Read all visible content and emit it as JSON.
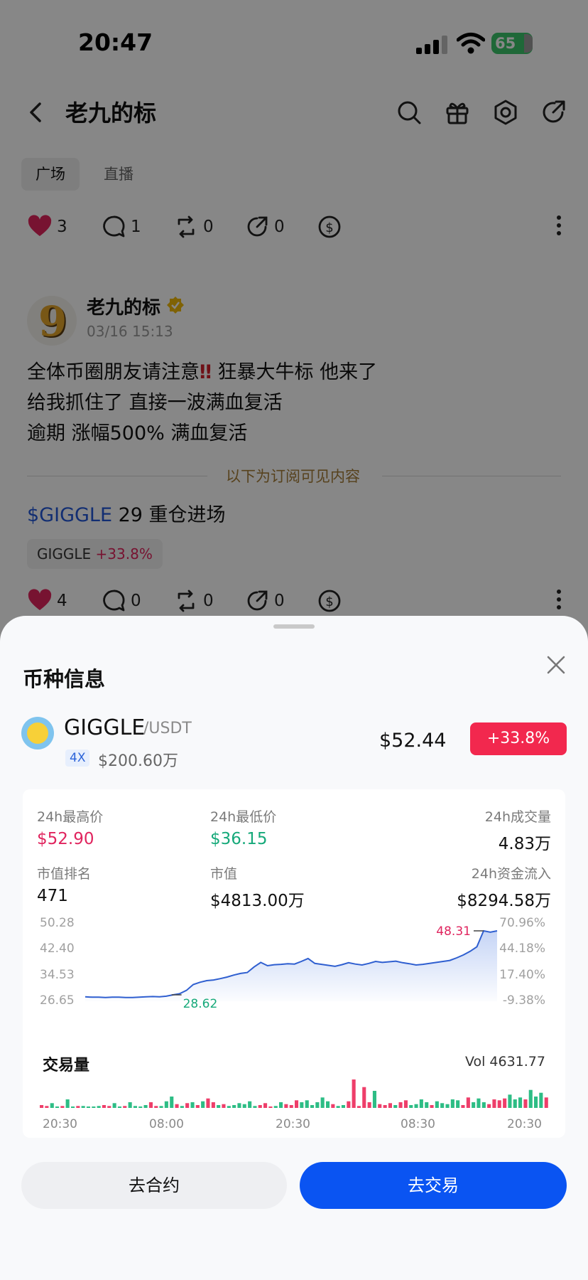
{
  "status_bar": {
    "time": "20:47",
    "battery": "65"
  },
  "nav": {
    "title": "老九的标",
    "icons": [
      "search-icon",
      "gift-icon",
      "settings-icon",
      "share-icon"
    ]
  },
  "tabs": [
    {
      "label": "广场",
      "active": true
    },
    {
      "label": "直播",
      "active": false
    }
  ],
  "top_actions": {
    "likes": "3",
    "comments": "1",
    "reposts": "0",
    "shares": "0"
  },
  "post": {
    "author": "老九的标",
    "time": "03/16 15:13",
    "lines": [
      "全体币圈朋友请注意",
      "狂暴大牛标 他来了",
      "给我抓住了 直接一波满血复活",
      "逾期 涨幅500% 满血复活"
    ],
    "bang": "‼",
    "subscriber_divider": "以下为订阅可见内容",
    "ticker": "$GIGGLE",
    "ticker_text": " 29 重仓进场",
    "chip_symbol": "GIGGLE",
    "chip_change": "+33.8%",
    "likes": "4",
    "comments": "0",
    "reposts": "0",
    "shares": "0"
  },
  "sheet": {
    "title": "币种信息",
    "coin": {
      "symbol": "GIGGLE",
      "quote": "/USDT",
      "leverage": "4X",
      "market_cap_short": "$200.60万",
      "price": "$52.44",
      "change": "+33.8%"
    },
    "stats": {
      "high_label": "24h最高价",
      "high": "$52.90",
      "low_label": "24h最低价",
      "low": "$36.15",
      "volume_label": "24h成交量",
      "volume": "4.83万",
      "rank_label": "市值排名",
      "rank": "471",
      "mcap_label": "市值",
      "mcap": "$4813.00万",
      "inflow_label": "24h资金流入",
      "inflow": "$8294.58万"
    },
    "volume_title": "交易量",
    "volume_total": "Vol 4631.77",
    "buttons": {
      "contract": "去合约",
      "trade": "去交易"
    }
  },
  "chart_data": {
    "type": "line",
    "title": "",
    "y_ticks_left": [
      "50.28",
      "42.40",
      "34.53",
      "26.65"
    ],
    "y_ticks_right": [
      "70.96%",
      "44.18%",
      "17.40%",
      "-9.38%"
    ],
    "x_ticks": [
      "20:30",
      "08:00",
      "20:30",
      "08:30",
      "20:30"
    ],
    "ylim": [
      26.65,
      50.28
    ],
    "annotations": {
      "high": "48.31",
      "low": "28.62"
    },
    "price": [
      28.0,
      27.9,
      27.9,
      27.8,
      27.9,
      27.9,
      27.8,
      27.8,
      27.9,
      28.0,
      28.1,
      28.0,
      28.2,
      28.62,
      29.0,
      30.0,
      31.8,
      32.5,
      33.0,
      33.2,
      33.6,
      34.1,
      34.7,
      35.2,
      35.5,
      37.2,
      38.6,
      37.6,
      37.9,
      38.0,
      38.2,
      38.1,
      38.9,
      39.8,
      38.3,
      38.0,
      37.7,
      37.4,
      37.9,
      38.5,
      38.1,
      37.8,
      38.3,
      38.9,
      38.6,
      38.8,
      39.0,
      38.5,
      38.2,
      37.8,
      38.0,
      38.3,
      38.6,
      38.9,
      39.2,
      40.0,
      40.9,
      42.0,
      43.4,
      48.31,
      47.9,
      48.3
    ],
    "volume": [
      3,
      2,
      5,
      1,
      2,
      9,
      1,
      2,
      2,
      1,
      1,
      2,
      3,
      2,
      5,
      1,
      2,
      6,
      2,
      1,
      3,
      6,
      2,
      2,
      7,
      12,
      4,
      2,
      5,
      6,
      3,
      7,
      10,
      6,
      3,
      4,
      2,
      3,
      5,
      4,
      7,
      2,
      3,
      5,
      1,
      2,
      6,
      4,
      3,
      8,
      6,
      8,
      3,
      6,
      11,
      7,
      4,
      2,
      3,
      7,
      30,
      2,
      22,
      6,
      18,
      4,
      3,
      5,
      3,
      6,
      8,
      3,
      4,
      9,
      6,
      3,
      7,
      5,
      4,
      9,
      8,
      3,
      11,
      6,
      10,
      6,
      4,
      9,
      8,
      10,
      14,
      9,
      11,
      9,
      19,
      12,
      16,
      11
    ]
  }
}
